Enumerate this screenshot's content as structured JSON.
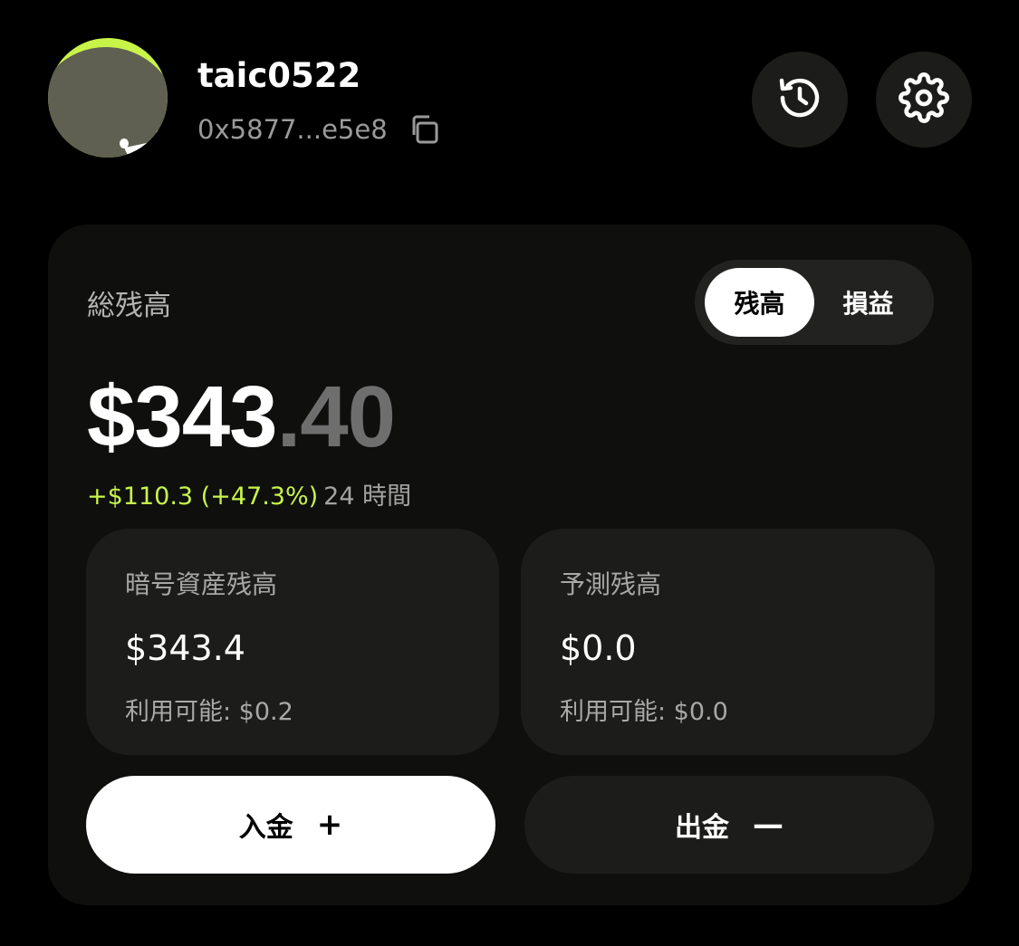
{
  "header": {
    "username": "taic0522",
    "address": "0x5877...e5e8",
    "icons": {
      "copy": "copy-icon",
      "history": "history-icon",
      "settings": "gear-icon"
    }
  },
  "card": {
    "title": "総残高",
    "toggle": {
      "options": [
        "残高",
        "損益"
      ],
      "selected": "残高"
    },
    "balance": {
      "whole": "$343",
      "cents": ".40"
    },
    "change": {
      "delta": "+$110.3 (+47.3%)",
      "period": "24 時間"
    },
    "sub_cards": [
      {
        "title": "暗号資産残高",
        "value": "$343.4",
        "available": "利用可能: $0.2"
      },
      {
        "title": "予測残高",
        "value": "$0.0",
        "available": "利用可能: $0.0"
      }
    ],
    "actions": {
      "deposit_label": "入金",
      "deposit_symbol": "+",
      "withdraw_label": "出金",
      "withdraw_symbol": "—"
    }
  },
  "colors": {
    "accent": "#c8f44a",
    "background": "#000000",
    "card": "#0f100e",
    "sub_card": "#1c1d1a"
  }
}
